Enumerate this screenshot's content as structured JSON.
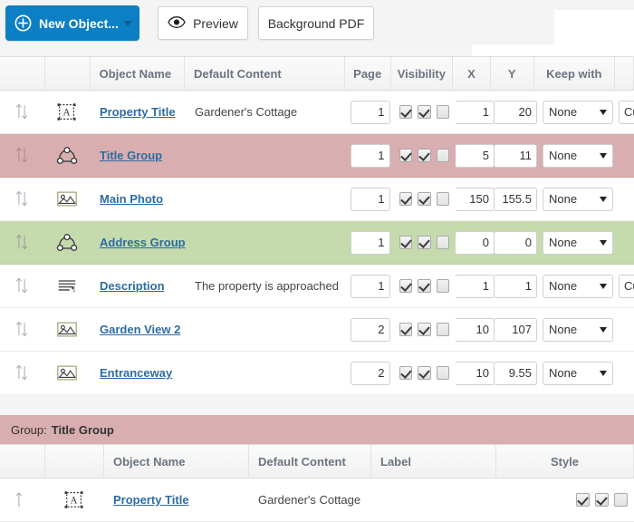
{
  "toolbar": {
    "new_object_label": "New Object...",
    "new_object_icon": "plus-circle-icon",
    "preview_label": "Preview",
    "preview_icon": "eye-icon",
    "background_pdf_label": "Background PDF",
    "accent_color": "#0d7fc4"
  },
  "main_grid": {
    "columns": [
      "",
      "",
      "Object Name",
      "Default Content",
      "Page",
      "Visibility",
      "X",
      "Y",
      "Keep with",
      ""
    ],
    "rows": [
      {
        "drag_icon": "reorder-updown-icon",
        "object_icon": "text-box-icon",
        "name": "Property Title",
        "default_content": "Gardener's Cottage",
        "page": "1",
        "vis1": true,
        "vis2": true,
        "vis3": false,
        "x": "1",
        "y": "20",
        "keep_with": "None",
        "cut_text": "Cu",
        "highlight": "none"
      },
      {
        "drag_icon": "reorder-updown-icon",
        "object_icon": "group-icon",
        "name": "Title Group",
        "default_content": "",
        "page": "1",
        "vis1": true,
        "vis2": true,
        "vis3": false,
        "x": "5",
        "y": "11",
        "keep_with": "None",
        "cut_text": "",
        "highlight": "pink"
      },
      {
        "drag_icon": "reorder-updown-icon",
        "object_icon": "image-icon",
        "name": "Main Photo",
        "default_content": "",
        "page": "1",
        "vis1": true,
        "vis2": true,
        "vis3": false,
        "x": "150",
        "y": "155.5",
        "keep_with": "None",
        "cut_text": "",
        "highlight": "none"
      },
      {
        "drag_icon": "reorder-updown-icon",
        "object_icon": "group-icon",
        "name": "Address Group",
        "default_content": "",
        "page": "1",
        "vis1": true,
        "vis2": true,
        "vis3": false,
        "x": "0",
        "y": "0",
        "keep_with": "None",
        "cut_text": "",
        "highlight": "green"
      },
      {
        "drag_icon": "reorder-updown-icon",
        "object_icon": "text-flow-icon",
        "name": "Description",
        "default_content": "The property is approached",
        "page": "1",
        "vis1": true,
        "vis2": true,
        "vis3": false,
        "x": "1",
        "y": "1",
        "keep_with": "None",
        "cut_text": "Cu",
        "highlight": "none"
      },
      {
        "drag_icon": "reorder-updown-icon",
        "object_icon": "image-icon",
        "name": "Garden View 2",
        "default_content": "",
        "page": "2",
        "vis1": true,
        "vis2": true,
        "vis3": false,
        "x": "10",
        "y": "107",
        "keep_with": "None",
        "cut_text": "",
        "highlight": "none"
      },
      {
        "drag_icon": "reorder-updown-icon",
        "object_icon": "image-icon",
        "name": "Entranceway",
        "default_content": "",
        "page": "2",
        "vis1": true,
        "vis2": true,
        "vis3": false,
        "x": "10",
        "y": "9.55",
        "keep_with": "None",
        "cut_text": "",
        "highlight": "none"
      }
    ]
  },
  "group_panel": {
    "bar_prefix": "Group:",
    "bar_name": "Title Group",
    "bar_color": "#d9aeb0",
    "columns": [
      "",
      "",
      "Object Name",
      "Default Content",
      "Label",
      "Style"
    ],
    "rows": [
      {
        "drag_icon": "reorder-up-icon",
        "object_icon": "text-box-icon",
        "name": "Property Title",
        "default_content": "Gardener's Cottage",
        "label": "",
        "vis1": true,
        "vis2": true,
        "vis3": false
      }
    ]
  }
}
